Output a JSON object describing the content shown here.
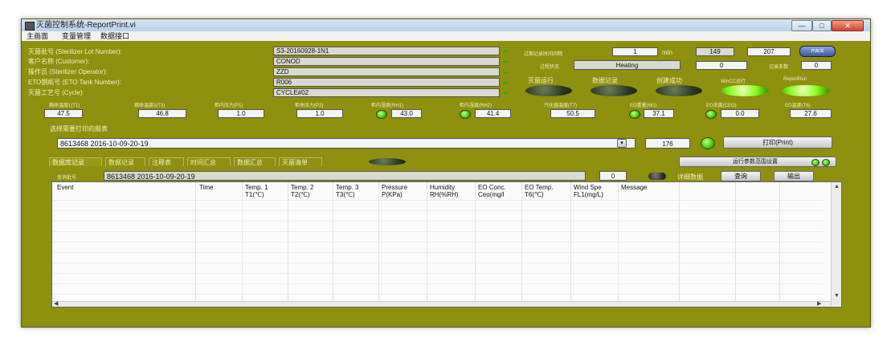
{
  "window": {
    "title": "灭菌控制系统-ReportPrint.vi",
    "min": "—",
    "max": "□",
    "close": "✕"
  },
  "menu": [
    "主画面",
    "变量管理",
    "数据接口"
  ],
  "form": {
    "lot_label": "灭菌批号 (Sterilizer Lot Number):",
    "lot_value": "S3-20160928-1N1",
    "customer_label": "客户名称 (Customer):",
    "customer_value": "CONOD",
    "operator_label": "操作员 (Sterilizer Operator):",
    "operator_value": "ZZD",
    "tank_label": "ETO钢瓶号 (ETO Tank Number):",
    "tank_value": "R006",
    "cycle_label": "灭菌工艺号 (Cycle):",
    "cycle_value": "CYCLE#02"
  },
  "top_right": {
    "interval_label": "过期记录时间间隔",
    "interval_value": "1",
    "interval_unit": "min",
    "count_a": "149",
    "count_b": "207",
    "toggle_label": "开启/关",
    "status_label": "过程状态",
    "status_value": "Heating",
    "status_number": "0",
    "record_label": "记录条数",
    "record_value": "0"
  },
  "indicators": {
    "sterilizing": "灭菌运行",
    "data_record": "数据记录",
    "created": "创建成功",
    "wincc": "WinCC运行",
    "report": "ReportRun"
  },
  "readings": [
    {
      "label": "箱体温度1(T1)",
      "value": "47.5"
    },
    {
      "label": "箱体温度2(T2)",
      "value": "46.8"
    },
    {
      "label": "柜内压力(P1)",
      "value": "1.0"
    },
    {
      "label": "柜体压力(P2)",
      "value": "1.0"
    },
    {
      "label": "柜内湿度(RH1)",
      "value": "43.0"
    },
    {
      "label": "柜内湿度(RH2)",
      "value": "41.4"
    },
    {
      "label": "汽化器温度(T7)",
      "value": "50.5"
    },
    {
      "label": "EO重量(W1)",
      "value": "37.1"
    },
    {
      "label": "EO浓度(CEO)",
      "value": "0.0"
    },
    {
      "label": "EO温度(T6)",
      "value": "27.6"
    }
  ],
  "report": {
    "select_label": "选择需要打印的报表",
    "select_value": "8613468 2016-10-09-20-19",
    "count": "176",
    "print_label": "打印(Print)"
  },
  "tabs": [
    "数据库记录",
    "数据记录",
    "注释表",
    "时间汇总",
    "数据汇总",
    "灭菌清单"
  ],
  "query": {
    "label": "查询批号",
    "value": "8613468 2016-10-09-20-19",
    "num": "0",
    "detail_label": "详细数据",
    "query_btn": "查询",
    "export_btn": "输出",
    "range_btn": "运行参数范围设置"
  },
  "table": {
    "headers": [
      "Event",
      "Time",
      "Temp. 1\nT1(℃)",
      "Temp. 2\nT2(℃)",
      "Temp. 3\nT3(℃)",
      "Pressure\nP(KPa)",
      "Humidity\nRH(%RH)",
      "EO Conc.\nCeo(mg/l",
      "EO Temp.\nT6(℃)",
      "Wind Spe\nFL1(mg/L)",
      "Message"
    ]
  },
  "colors": {
    "panel": "#8f8f10",
    "led_on": "#86ff22",
    "led_off": "#2c3a22"
  },
  "icons": [
    "app-icon",
    "minimize-icon",
    "maximize-icon",
    "close-icon",
    "dropdown-arrow-icon",
    "scroll-up-icon",
    "scroll-down-icon",
    "scroll-left-icon",
    "scroll-right-icon"
  ]
}
